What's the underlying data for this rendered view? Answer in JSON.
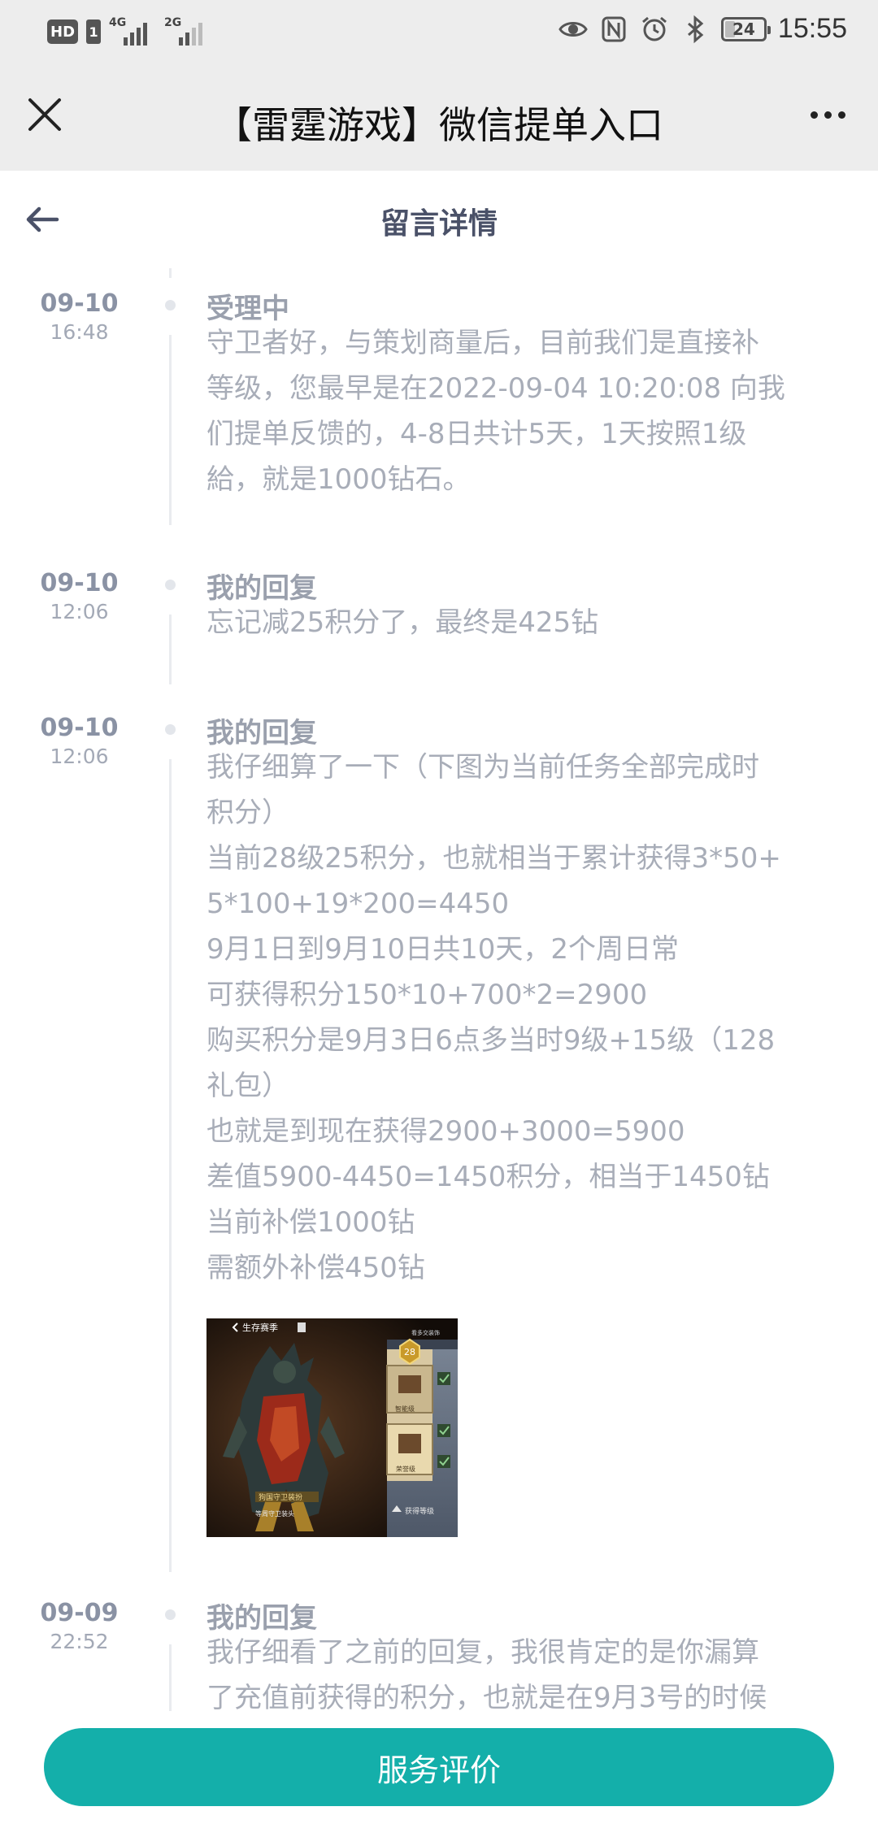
{
  "status_bar": {
    "hd_label": "HD",
    "sim_label": "1",
    "signal1_net": "4G",
    "signal2_net": "2G",
    "battery_level": "24",
    "time": "15:55",
    "icons": [
      "eye-comfort-icon",
      "nfc-icon",
      "alarm-icon",
      "bluetooth-icon",
      "battery-icon"
    ]
  },
  "title_bar": {
    "title": "【雷霆游戏】微信提单入口",
    "close_icon": "close-icon",
    "more_icon": "more-icon"
  },
  "page": {
    "title": "留言详情",
    "back_icon": "back-arrow-icon"
  },
  "entries": [
    {
      "date": "09-10",
      "time": "16:48",
      "status": "受理中",
      "lines": [
        "守卫者好，与策划商量后，目前我们是直接补",
        "等级，您最早是在2022-09-04 10:20:08 向我",
        "们提单反馈的，4-8日共计5天，1天按照1级",
        "給，就是1000钻石。"
      ]
    },
    {
      "date": "09-10",
      "time": "12:06",
      "status": "我的回复",
      "lines": [
        "忘记减25积分了，最终是425钻"
      ]
    },
    {
      "date": "09-10",
      "time": "12:06",
      "status": "我的回复",
      "lines": [
        "我仔细算了一下（下图为当前任务全部完成时",
        "积分）",
        "当前28级25积分，也就相当于累计获得3*50+",
        "5*100+19*200=4450",
        "9月1日到9月10日共10天，2个周日常",
        "可获得积分150*10+700*2=2900",
        "购买积分是9月3日6点多当时9级+15级（128",
        "礼包）",
        "也就是到现在获得2900+3000=5900",
        "差值5900-4450=1450积分，相当于1450钻",
        "当前补偿1000钻",
        "需额外补偿450钻"
      ],
      "attachment": {
        "header_text": "生存赛季",
        "level_badge": "28",
        "tag_text": "狗国守卫装扮",
        "caption_text": "等周守卫装头",
        "card1_label": "智能级",
        "card2_label": "荣誉级",
        "bottom_right_text": "获得等级",
        "top_right_text": "看多交装饰"
      }
    },
    {
      "date": "09-09",
      "time": "22:52",
      "status": "我的回复",
      "lines": [
        "我仔细看了之前的回复，我很肯定的是你漏算",
        "了充值前获得的积分，也就是在9月3号的时候"
      ]
    }
  ],
  "bottom": {
    "rate_button": "服务评价"
  },
  "colors": {
    "status_bg": "#ededed",
    "accent": "#14afaa",
    "date_text": "#8a92a4",
    "body_text": "#a8adb8"
  }
}
